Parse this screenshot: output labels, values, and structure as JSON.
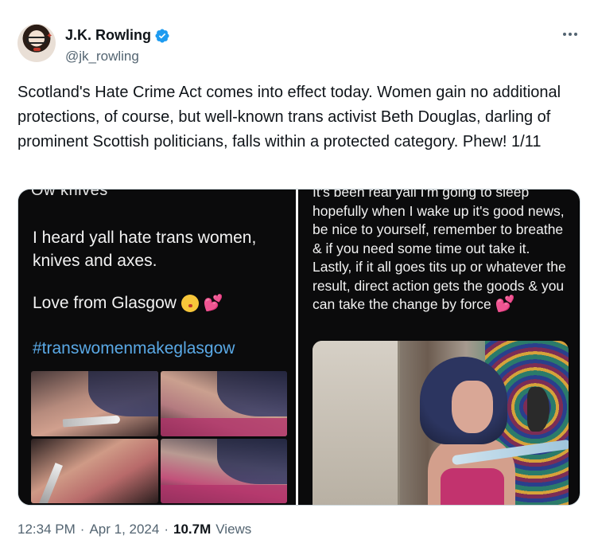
{
  "author": {
    "display_name": "J.K. Rowling",
    "handle": "@jk_rowling",
    "verified": true,
    "verified_color": "#1d9bf0"
  },
  "tweet": {
    "text": "Scotland's Hate Crime Act comes into effect today. Women gain no additional protections, of course, but well-known trans activist Beth Douglas, darling of prominent Scottish politicians, falls within a protected category. Phew! 1/11"
  },
  "media": {
    "left": {
      "cut_top": "Ow knives",
      "line1": "I heard yall hate trans women, knives and axes.",
      "love": "Love from Glasgow",
      "hashtag": "#transwomenmakeglasgow",
      "hashtag_color": "#5aa9e6"
    },
    "right": {
      "text": "It's been real yall I'm going to sleep hopefully when I wake up it's good news, be nice to yourself, remember to breathe & if you need some time out take it. Lastly, if it all goes tits up or whatever the result, direct action gets the goods & you can take the change by force"
    }
  },
  "meta": {
    "time": "12:34 PM",
    "date": "Apr 1, 2024",
    "views_count": "10.7M",
    "views_label": "Views",
    "separator": "·"
  },
  "colors": {
    "text_primary": "#0f1419",
    "text_secondary": "#536471",
    "border": "#cfd9de"
  }
}
